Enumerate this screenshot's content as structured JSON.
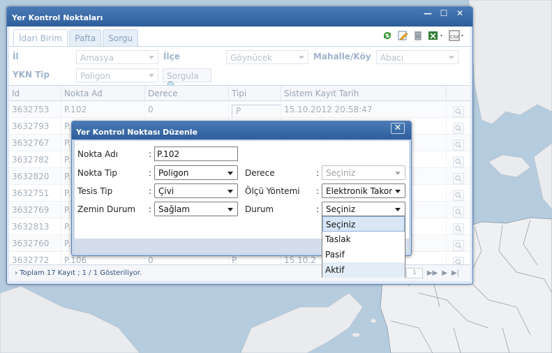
{
  "main_window": {
    "title": "Yer Kontrol Noktaları",
    "tabs": [
      "İdari Birim",
      "Pafta",
      "Sorgu"
    ],
    "toolbar_icons": [
      "refresh-icon",
      "edit-icon",
      "trash-icon",
      "excel-icon",
      "csv-icon"
    ],
    "filters": {
      "il_label": "İl",
      "il_value": "Amasya",
      "ilce_label": "İlçe",
      "ilce_value": "Göynücek",
      "mahalle_label": "Mahalle/Köy",
      "mahalle_value": "Abacı",
      "ykn_label": "YKN Tip",
      "ykn_value": "Poligon",
      "sorgula_label": "Sorgula"
    },
    "grid": {
      "headers": [
        "Id",
        "Nokta Ad",
        "Derece",
        "Tipi",
        "Sistem Kayıt Tarih"
      ],
      "rows": [
        [
          "3632753",
          "P.102",
          "0",
          "P",
          "15.10.2012 20:58:47"
        ],
        [
          "3632793",
          "P.",
          "",
          "",
          ""
        ],
        [
          "3632767",
          "P.",
          "",
          "",
          ""
        ],
        [
          "3632782",
          "P.",
          "",
          "",
          ""
        ],
        [
          "3632820",
          "P.",
          "",
          "",
          ""
        ],
        [
          "3632751",
          "P.",
          "",
          "",
          ""
        ],
        [
          "3632769",
          "P.",
          "",
          "",
          ""
        ],
        [
          "3632813",
          "P.",
          "",
          "",
          ""
        ],
        [
          "3632760",
          "P.",
          "",
          "",
          ""
        ],
        [
          "3632772",
          "P.106",
          "0",
          "P",
          "15.10.2"
        ]
      ]
    },
    "status": {
      "text": "Toplam 17 Kayıt ; 1 / 1 Gösteriliyor.",
      "page": "1"
    }
  },
  "modal": {
    "title": "Yer Kontrol Noktası Düzenle",
    "nokta_adi_label": "Nokta Adı",
    "nokta_adi_value": "P.102",
    "nokta_tip_label": "Nokta Tip",
    "nokta_tip_value": "Poligon",
    "tesis_tip_label": "Tesis Tip",
    "tesis_tip_value": "Çivi",
    "zemin_label": "Zemin Durum",
    "zemin_value": "Sağlam",
    "derece_label": "Derece",
    "derece_value": "Seçiniz",
    "olcu_label": "Ölçü Yöntemi",
    "olcu_value": "Elektronik Takometre",
    "durum_label": "Durum",
    "durum_value": "Seçiniz",
    "colon": ":",
    "durum_options": [
      "Seçiniz",
      "Taslak",
      "Pasif",
      "Aktif"
    ]
  },
  "window_buttons": {
    "close": "✕",
    "minimize": "—",
    "maximize": "☐"
  },
  "colors": {
    "titlebar": "#2d5d9a",
    "map_sea": "#b5ccdf",
    "map_land": "#e9ebee"
  }
}
